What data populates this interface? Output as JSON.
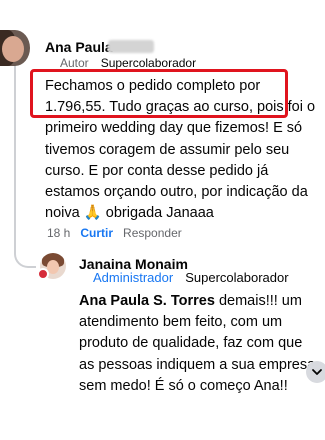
{
  "comment": {
    "author": "Ana Paula",
    "badges": {
      "autor": "Autor",
      "super": "Supercolaborador"
    },
    "lines": [
      "Fechamos o pedido completo por",
      "1.796,55. Tudo graças ao curso, pois foi o",
      "primeiro wedding day que fizemos! E só",
      "tivemos coragem de assumir pelo seu",
      "curso. E por conta desse pedido já",
      "estamos orçando outro, por indicação da",
      "noiva",
      "obrigada Janaaa"
    ],
    "emoji": "🙏",
    "time": "18 h",
    "like_label": "Curtir",
    "reply_label": "Responder"
  },
  "reply": {
    "author": "Janaina Monaim",
    "badges": {
      "admin": "Administrador",
      "super": "Supercolaborador"
    },
    "mention": "Ana Paula S. Torres",
    "lines": [
      "demais!!! um",
      "atendimento bem feito, com um",
      "produto de qualidade, faz com que",
      "as pessoas indiquem a sua empresa",
      "sem medo! É só o começo Ana!!"
    ]
  },
  "colors": {
    "highlight": "#e0141e",
    "link": "#1877f2",
    "muted": "#65676b"
  },
  "icons": {
    "scroll": "chevron-down-icon"
  }
}
